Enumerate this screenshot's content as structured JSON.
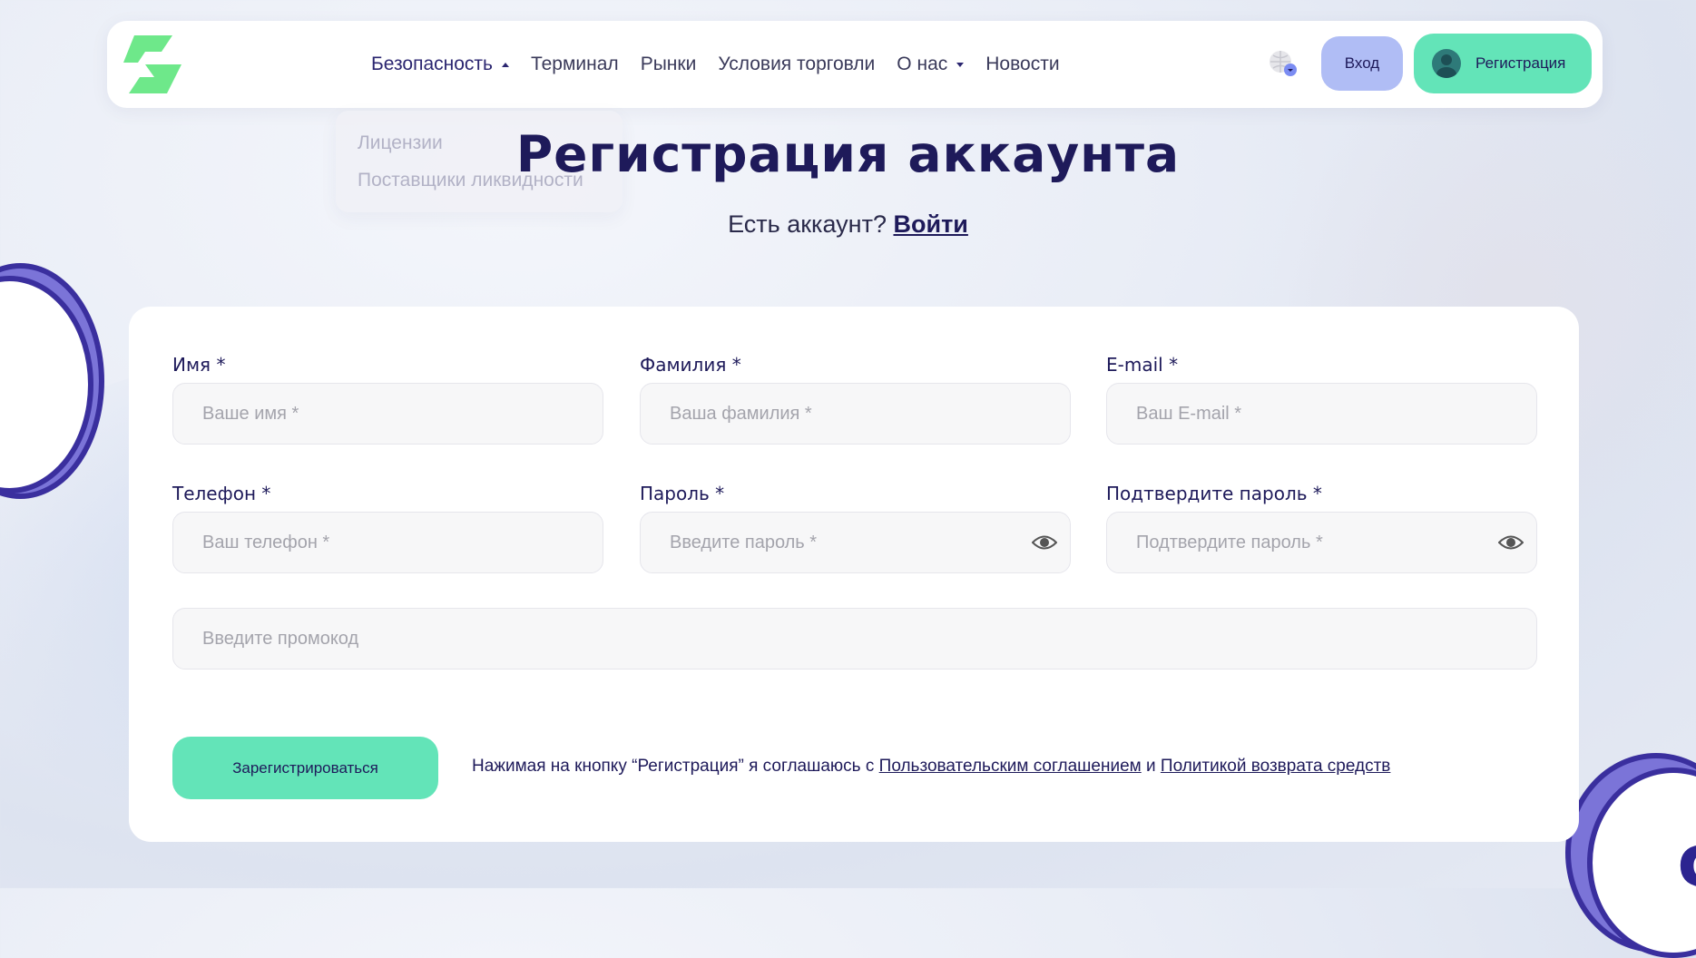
{
  "nav": {
    "items": [
      {
        "label": "Безопасность",
        "caret": "up"
      },
      {
        "label": "Терминал"
      },
      {
        "label": "Рынки"
      },
      {
        "label": "Условия торговли"
      },
      {
        "label": "О нас",
        "caret": "down"
      },
      {
        "label": "Новости"
      }
    ],
    "dropdown": [
      "Лицензии",
      "Поставщики ликвидности"
    ],
    "login_label": "Вход",
    "register_label": "Регистрация"
  },
  "page": {
    "title": "Регистрация аккаунта",
    "subtitle_text": "Есть аккаунт?",
    "subtitle_link": "Войти"
  },
  "form": {
    "first_name": {
      "label": "Имя *",
      "placeholder": "Ваше имя *"
    },
    "last_name": {
      "label": "Фамилия *",
      "placeholder": "Ваша фамилия *"
    },
    "email": {
      "label": "E-mail *",
      "placeholder": "Ваш E-mail *"
    },
    "phone": {
      "label": "Телефон *",
      "placeholder": "Ваш телефон *"
    },
    "password": {
      "label": "Пароль *",
      "placeholder": "Введите пароль *"
    },
    "password_confirm": {
      "label": "Подтвердите пароль *",
      "placeholder": "Подтвердите пароль *"
    },
    "promo": {
      "placeholder": "Введите промокод"
    },
    "submit_label": "Зарегистрироваться",
    "agree_text": "Нажимая на кнопку “Регистрация” я соглашаюсь с",
    "agree_link1": "Пользовательским соглашением",
    "agree_and": "и",
    "agree_link2": "Политикой возврата средств"
  },
  "colors": {
    "accent": "#63e4b8",
    "login_bg": "#b0bdf5",
    "navy": "#1e1a5a",
    "logo_green": "#6ee88a"
  },
  "icons": [
    "logo-icon",
    "globe-icon",
    "user-avatar-icon",
    "eye-icon",
    "coin-icon"
  ]
}
